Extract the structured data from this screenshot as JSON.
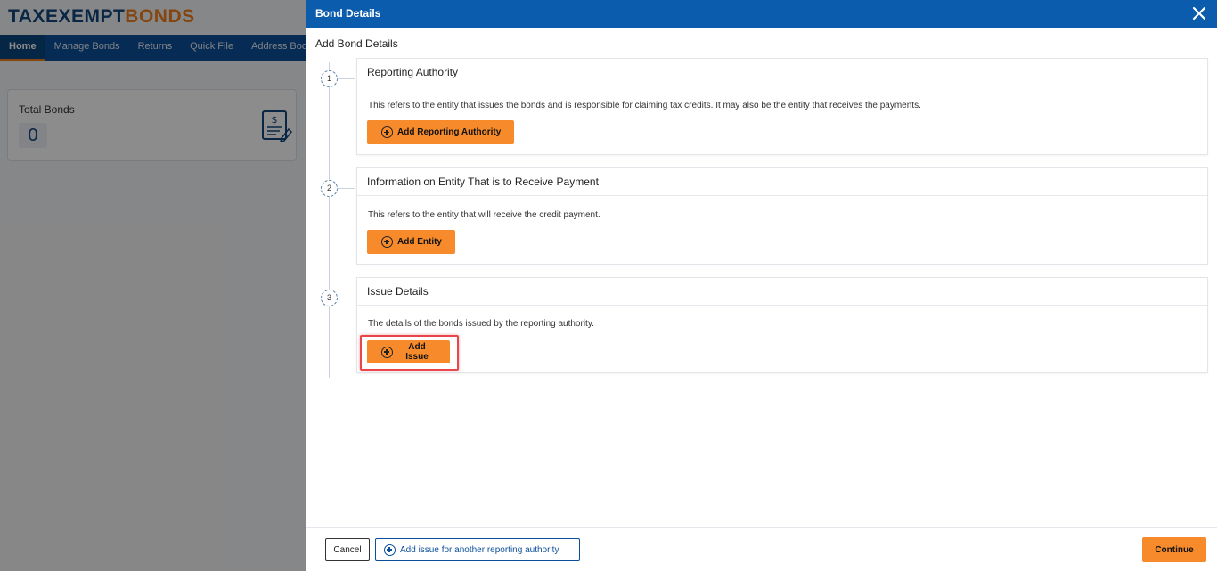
{
  "app": {
    "logo_part1": "TAXEXEMPT",
    "logo_part2": "BONDS",
    "nav": [
      "Home",
      "Manage Bonds",
      "Returns",
      "Quick File",
      "Address Book"
    ],
    "stat_label": "Total Bonds",
    "stat_value": "0"
  },
  "drawer": {
    "title": "Bond Details",
    "subtitle": "Add Bond Details",
    "steps": [
      {
        "number": "1",
        "title": "Reporting Authority",
        "description": "This refers to the entity that issues the bonds and is responsible for claiming tax credits. It may also be the entity that receives the payments.",
        "button": "Add Reporting Authority"
      },
      {
        "number": "2",
        "title": "Information on Entity That is to Receive Payment",
        "description": "This refers to the entity that will receive the credit payment.",
        "button": "Add Entity"
      },
      {
        "number": "3",
        "title": "Issue Details",
        "description": "The details of the bonds issued by the reporting authority.",
        "button": "Add Issue"
      }
    ],
    "footer": {
      "cancel": "Cancel",
      "add_another": "Add issue for another reporting authority",
      "continue": "Continue"
    }
  },
  "colors": {
    "header_blue": "#0b5cad",
    "nav_blue": "#0b4f99",
    "accent_orange": "#f78b2b",
    "highlight_red": "#e8464a"
  }
}
